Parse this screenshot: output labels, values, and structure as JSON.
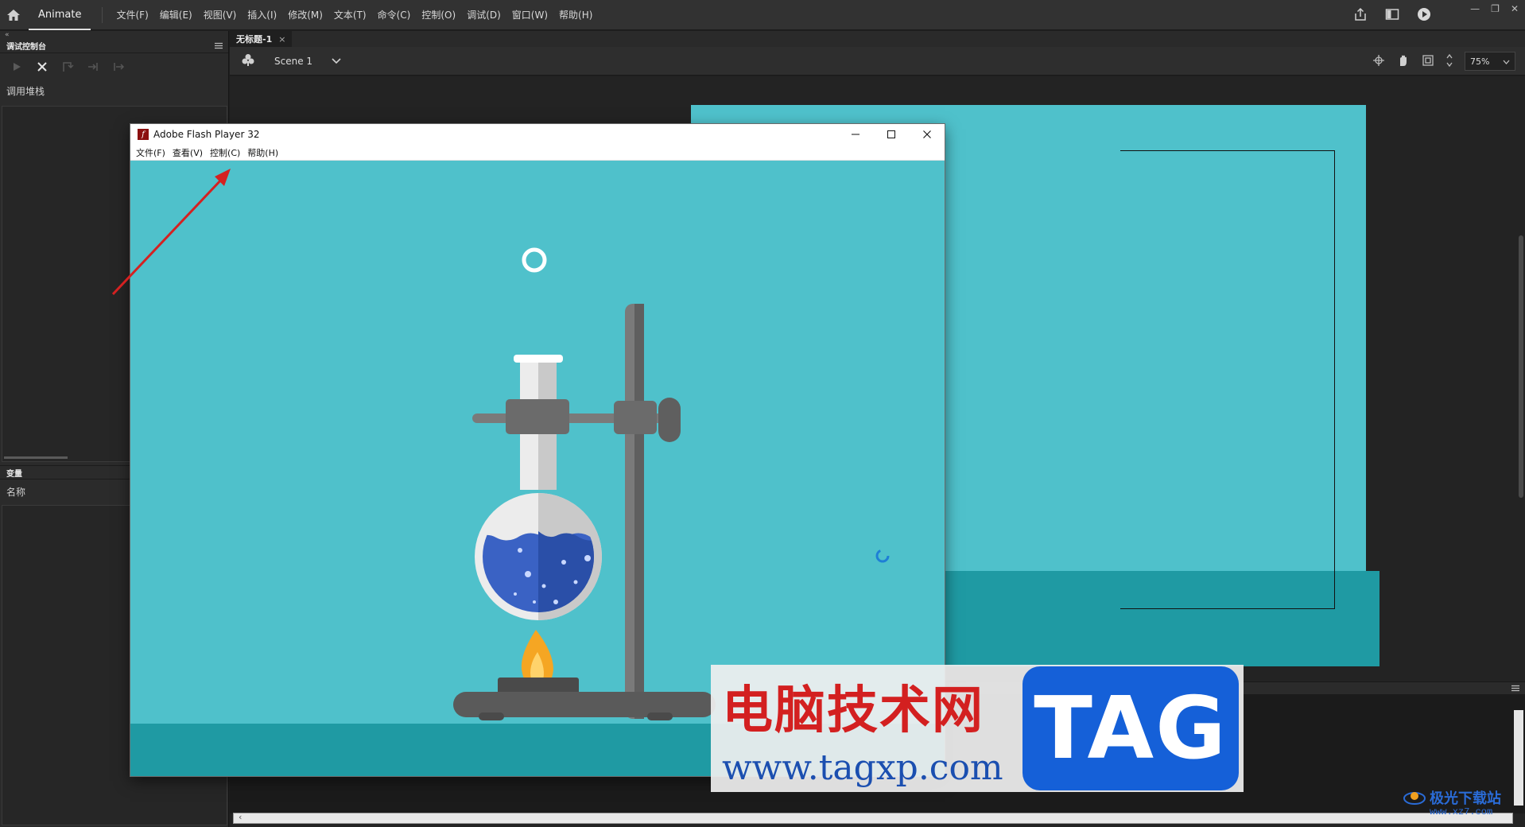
{
  "menubar": {
    "app_name": "Animate",
    "items": [
      "文件(F)",
      "编辑(E)",
      "视图(V)",
      "插入(I)",
      "修改(M)",
      "文本(T)",
      "命令(C)",
      "控制(O)",
      "调试(D)",
      "窗口(W)",
      "帮助(H)"
    ]
  },
  "debug_panel": {
    "collapse": "«",
    "title": "调试控制台",
    "call_stack_label": "调用堆栈",
    "variables_title": "变量",
    "name_column": "名称"
  },
  "document": {
    "tab_label": "无标题-1",
    "tab_close": "×",
    "scene_name": "Scene 1",
    "zoom": "75%"
  },
  "flash_player": {
    "title": "Adobe Flash Player 32",
    "logo_letter": "f",
    "menus": [
      "文件(F)",
      "查看(V)",
      "控制(C)",
      "帮助(H)"
    ],
    "minimize": "—",
    "maximize": "☐",
    "close": "✕"
  },
  "watermark": {
    "title": "电脑技术网",
    "url": "www.tagxp.com",
    "logo_text": "TAG"
  },
  "corner_badge": {
    "title": "极光下载站",
    "url": "www.xz7.com"
  },
  "colors": {
    "stage_teal": "#4fc1cb",
    "ground_teal": "#1f9aa3",
    "liquid_blue": "#2d55b5",
    "flame_orange": "#f5a623",
    "annotation_red": "#d42121"
  }
}
